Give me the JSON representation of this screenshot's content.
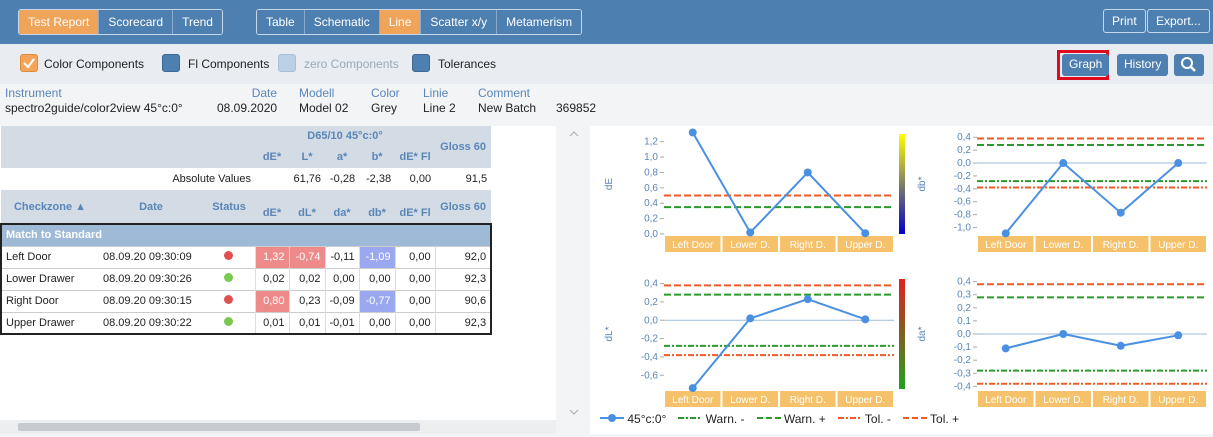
{
  "toolbar": {
    "group1": [
      "Test Report",
      "Scorecard",
      "Trend"
    ],
    "group2": [
      "Table",
      "Schematic",
      "Line",
      "Scatter x/y",
      "Metamerism"
    ],
    "active": [
      "Test Report",
      "Line"
    ],
    "print_label": "Print",
    "export_label": "Export..."
  },
  "subbar": {
    "color_components": "Color Components",
    "fl_components": "Fl Components",
    "zero_components": "zero Components",
    "tolerances": "Tolerances",
    "graph_label": "Graph",
    "history_label": "History"
  },
  "info": {
    "instrument_label": "Instrument",
    "instrument": "spectro2guide/color2view 45°c:0°",
    "date_label": "Date",
    "date": "08.09.2020",
    "modell_label": "Modell",
    "modell": "Model 02",
    "color_label": "Color",
    "color": "Grey",
    "linie_label": "Linie",
    "linie": "Line 2",
    "comment_label": "Comment",
    "comment": "New Batch",
    "extra": "369852"
  },
  "table": {
    "illuminant": "D65/10  45°c:0°",
    "top_headers": [
      "dE*",
      "L*",
      "a*",
      "b*",
      "dE* Fl"
    ],
    "gloss": "Gloss 60",
    "absolute_label": "Absolute Values",
    "absolute_values": [
      "",
      "61,76",
      "-0,28",
      "-2,38",
      "0,00",
      "91,5"
    ],
    "row_headers": [
      "Checkzone ▲",
      "Date",
      "Status"
    ],
    "col_headers": [
      "dE*",
      "dL*",
      "da*",
      "db*",
      "dE* Fl"
    ],
    "group_label": "Match to Standard",
    "rows": [
      {
        "name": "Left Door",
        "date": "08.09.20 09:30:09",
        "status": "#e05050",
        "vals": [
          "1,32",
          "-0,74",
          "-0,11",
          "-1,09",
          "0,00",
          "92,0"
        ]
      },
      {
        "name": "Lower Drawer",
        "date": "08.09.20 09:30:26",
        "status": "#79c850",
        "vals": [
          "0,02",
          "0,02",
          "0,00",
          "0,00",
          "0,00",
          "92,3"
        ]
      },
      {
        "name": "Right Door",
        "date": "08.09.20 09:30:15",
        "status": "#e05050",
        "vals": [
          "0,80",
          "0,23",
          "-0,09",
          "-0,77",
          "0,00",
          "90,6"
        ]
      },
      {
        "name": "Upper Drawer",
        "date": "08.09.20 09:30:22",
        "status": "#79c850",
        "vals": [
          "0,01",
          "0,01",
          "-0,01",
          "0,00",
          "0,00",
          "92,3"
        ]
      }
    ]
  },
  "chart_data": [
    {
      "type": "line",
      "ylabel": "dE",
      "categories": [
        "Left Door",
        "Lower D.",
        "Right D.",
        "Upper D."
      ],
      "series": [
        {
          "name": "45°c:0°",
          "values": [
            1.32,
            0.02,
            0.8,
            0.01
          ]
        }
      ],
      "ylim": [
        0,
        1.3
      ],
      "ticks": [
        "0,0",
        "0,2",
        "0,4",
        "0,6",
        "0,8",
        "1,0",
        "1,2"
      ],
      "warn": [
        0.35
      ],
      "tol": [
        0.5
      ],
      "colorbar": [
        "#ffff00",
        "#0000cc"
      ]
    },
    {
      "type": "line",
      "ylabel": "db*",
      "categories": [
        "Left Door",
        "Lower D.",
        "Right D.",
        "Upper D."
      ],
      "series": [
        {
          "name": "45°c:0°",
          "values": [
            -1.09,
            0.0,
            -0.77,
            0.0
          ]
        }
      ],
      "ylim": [
        -1.1,
        0.45
      ],
      "ticks": [
        "-1,0",
        "-0,8",
        "-0,6",
        "-0,4",
        "-0,2",
        "0,0",
        "0,2",
        "0,4"
      ],
      "warn": [
        -0.28,
        0.28
      ],
      "tol": [
        -0.38,
        0.38
      ],
      "colorbar": [
        "#ffff00",
        "#0000cc"
      ]
    },
    {
      "type": "line",
      "ylabel": "dL*",
      "categories": [
        "Left Door",
        "Lower D.",
        "Right D.",
        "Upper D."
      ],
      "series": [
        {
          "name": "45°c:0°",
          "values": [
            -0.74,
            0.02,
            0.23,
            0.01
          ]
        }
      ],
      "ylim": [
        -0.75,
        0.45
      ],
      "ticks": [
        "-0,6",
        "-0,4",
        "-0,2",
        "0,0",
        "0,2",
        "0,4"
      ],
      "warn": [
        -0.28,
        0.28
      ],
      "tol": [
        -0.38,
        0.38
      ],
      "colorbar": [
        "#ffffff",
        "#000000"
      ]
    },
    {
      "type": "line",
      "ylabel": "da*",
      "categories": [
        "Left Door",
        "Lower D.",
        "Right D.",
        "Upper D."
      ],
      "series": [
        {
          "name": "45°c:0°",
          "values": [
            -0.11,
            0.0,
            -0.09,
            -0.01
          ]
        }
      ],
      "ylim": [
        -0.42,
        0.42
      ],
      "ticks": [
        "-0,4",
        "-0,3",
        "-0,2",
        "-0,1",
        "0,0",
        "0,1",
        "0,2",
        "0,3",
        "0,4"
      ],
      "warn": [
        -0.28,
        0.28
      ],
      "tol": [
        -0.38,
        0.38
      ],
      "colorbar": [
        "#e02020",
        "#20a020"
      ]
    }
  ],
  "legend": {
    "items": [
      "45°c:0°",
      "Warn. -",
      "Warn. +",
      "Tol. -",
      "Tol. +"
    ],
    "series_color": "#4a90e2",
    "warn_color": "#2a9a2a",
    "tol_color": "#f05a28"
  }
}
